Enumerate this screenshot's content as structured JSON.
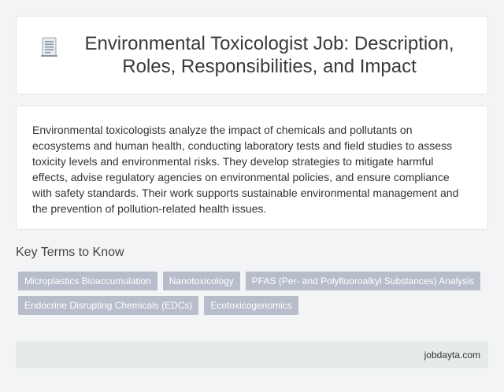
{
  "header": {
    "icon": "document-icon",
    "title": "Environmental Toxicologist Job: Description, Roles, Responsibilities, and Impact"
  },
  "description": "Environmental toxicologists analyze the impact of chemicals and pollutants on ecosystems and human health, conducting laboratory tests and field studies to assess toxicity levels and environmental risks. They develop strategies to mitigate harmful effects, advise regulatory agencies on environmental policies, and ensure compliance with safety standards. Their work supports sustainable environmental management and the prevention of pollution-related health issues.",
  "key_terms": {
    "heading": "Key Terms to Know",
    "tags": [
      "Microplastics Bioaccumulation",
      "Nanotoxicology",
      "PFAS (Per- and Polyfluoroalkyl Substances) Analysis",
      "Endocrine Disrupting Chemicals (EDCs)",
      "Ecotoxicogenomics"
    ]
  },
  "footer": {
    "site": "jobdayta.com"
  },
  "colors": {
    "tag_bg": "#b7bdcb",
    "footer_bg": "#e6ebea",
    "page_bg": "#f3f4f6"
  }
}
